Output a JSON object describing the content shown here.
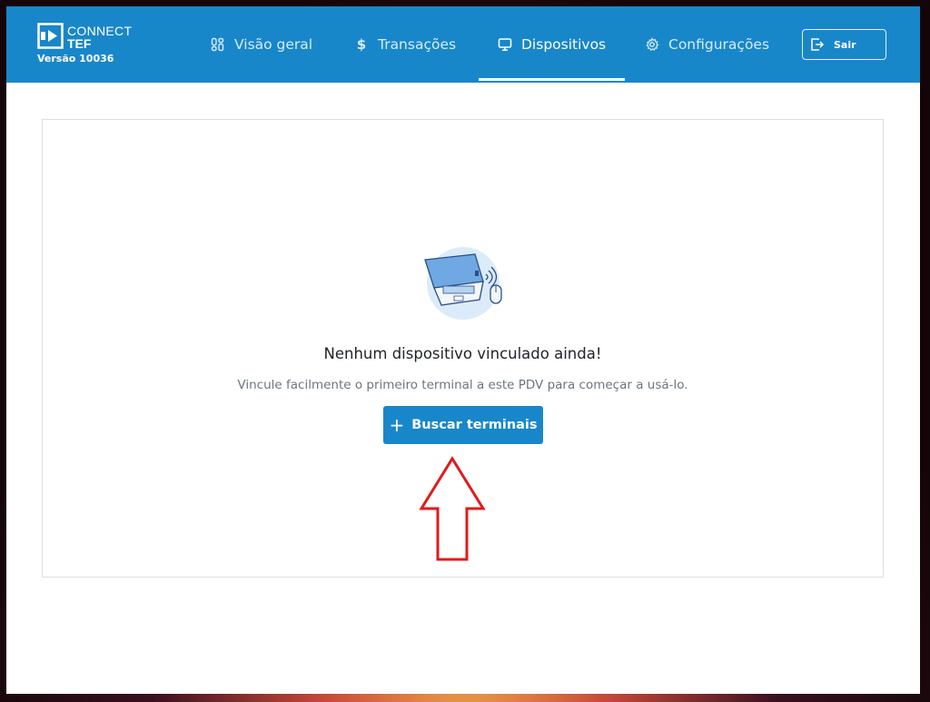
{
  "brand": {
    "line1": "CONNECT",
    "line2": "TEF",
    "version": "Versão 10036"
  },
  "nav": [
    {
      "label": "Visão geral",
      "icon": "overview-icon",
      "active": false
    },
    {
      "label": "Transações",
      "icon": "dollar-icon",
      "active": false
    },
    {
      "label": "Dispositivos",
      "icon": "monitor-icon",
      "active": true
    },
    {
      "label": "Configurações",
      "icon": "gear-icon",
      "active": false
    }
  ],
  "logout": {
    "label": "Sair",
    "icon": "logout-icon"
  },
  "empty_state": {
    "illustration": "laptop-wireless-illustration",
    "title": "Nenhum dispositivo vinculado ainda!",
    "description": "Vincule facilmente o primeiro terminal a este PDV para começar a usá-lo.",
    "button_label": "Buscar terminais",
    "button_icon": "plus-icon"
  },
  "annotation": {
    "icon": "red-arrow-up-annotation"
  },
  "colors": {
    "primary": "#1887c9",
    "nav_text": "#d8ecf9",
    "annotation_red": "#e01b1b"
  }
}
